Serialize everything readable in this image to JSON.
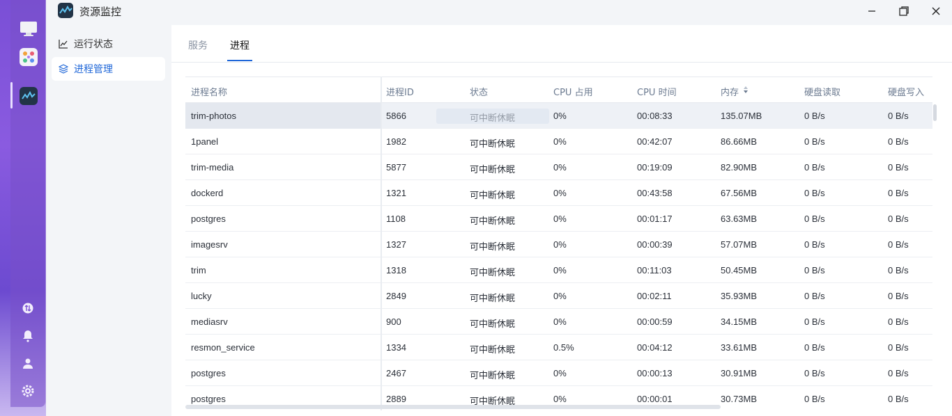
{
  "app": {
    "title": "资源监控",
    "icon": "resource-monitor-icon"
  },
  "window_controls": {
    "minimize": "minimize-icon",
    "maximize": "maximize-icon",
    "close": "close-icon"
  },
  "sidebar": {
    "items": [
      {
        "label": "运行状态",
        "icon": "line-chart-icon",
        "active": false
      },
      {
        "label": "进程管理",
        "icon": "layers-icon",
        "active": true
      }
    ]
  },
  "tabs": [
    {
      "label": "服务",
      "active": false
    },
    {
      "label": "进程",
      "active": true
    }
  ],
  "table": {
    "columns": [
      "进程名称",
      "进程ID",
      "状态",
      "CPU 占用",
      "CPU 时间",
      "内存",
      "硬盘读取",
      "硬盘写入"
    ],
    "sort_icon": "sort-icon",
    "rows": [
      [
        "trim-photos",
        "5866",
        "可中断休眠",
        "0%",
        "00:08:33",
        "135.07MB",
        "0 B/s",
        "0 B/s"
      ],
      [
        "1panel",
        "1982",
        "可中断休眠",
        "0%",
        "00:42:07",
        "86.66MB",
        "0 B/s",
        "0 B/s"
      ],
      [
        "trim-media",
        "5877",
        "可中断休眠",
        "0%",
        "00:19:09",
        "82.90MB",
        "0 B/s",
        "0 B/s"
      ],
      [
        "dockerd",
        "1321",
        "可中断休眠",
        "0%",
        "00:43:58",
        "67.56MB",
        "0 B/s",
        "0 B/s"
      ],
      [
        "postgres",
        "1108",
        "可中断休眠",
        "0%",
        "00:01:17",
        "63.63MB",
        "0 B/s",
        "0 B/s"
      ],
      [
        "imagesrv",
        "1327",
        "可中断休眠",
        "0%",
        "00:00:39",
        "57.07MB",
        "0 B/s",
        "0 B/s"
      ],
      [
        "trim",
        "1318",
        "可中断休眠",
        "0%",
        "00:11:03",
        "50.45MB",
        "0 B/s",
        "0 B/s"
      ],
      [
        "lucky",
        "2849",
        "可中断休眠",
        "0%",
        "00:02:11",
        "35.93MB",
        "0 B/s",
        "0 B/s"
      ],
      [
        "mediasrv",
        "900",
        "可中断休眠",
        "0%",
        "00:00:59",
        "34.15MB",
        "0 B/s",
        "0 B/s"
      ],
      [
        "resmon_service",
        "1334",
        "可中断休眠",
        "0.5%",
        "00:04:12",
        "33.61MB",
        "0 B/s",
        "0 B/s"
      ],
      [
        "postgres",
        "2467",
        "可中断休眠",
        "0%",
        "00:00:13",
        "30.91MB",
        "0 B/s",
        "0 B/s"
      ],
      [
        "postgres",
        "2889",
        "可中断休眠",
        "0%",
        "00:00:01",
        "30.73MB",
        "0 B/s",
        "0 B/s"
      ]
    ]
  },
  "dock": {
    "apps": [
      "desktop-icon",
      "app-center-icon",
      "resource-monitor-icon"
    ],
    "bottom": [
      "transfer-icon",
      "bell-icon",
      "user-icon",
      "settings-icon"
    ]
  },
  "colors": {
    "accent": "#1e66d8",
    "dock": "#7a4fd6"
  }
}
